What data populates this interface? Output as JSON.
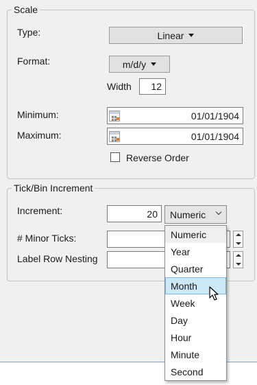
{
  "scale": {
    "title": "Scale",
    "type_label": "Type:",
    "type_value": "Linear",
    "format_label": "Format:",
    "format_value": "m/d/y",
    "width_label": "Width",
    "width_value": "12",
    "minimum_label": "Minimum:",
    "minimum_value": "01/01/1904",
    "maximum_label": "Maximum:",
    "maximum_value": "01/01/1904",
    "reverse_order_label": "Reverse Order",
    "reverse_order_checked": false
  },
  "tick": {
    "title": "Tick/Bin Increment",
    "increment_label": "Increment:",
    "increment_value": "20",
    "unit_value": "Numeric",
    "minor_ticks_label": "# Minor Ticks:",
    "minor_ticks_value": "",
    "label_row_nesting_label": "Label Row Nesting",
    "label_row_nesting_value": ""
  },
  "unit_dropdown": {
    "options": [
      "Numeric",
      "Year",
      "Quarter",
      "Month",
      "Week",
      "Day",
      "Hour",
      "Minute",
      "Second"
    ],
    "selected": "Numeric",
    "hovered": "Month"
  },
  "icons": {
    "calendar": "calendar-icon",
    "caret": "caret-down-icon",
    "chevron": "chevron-down-icon",
    "spinner": "spin-arrows-icon",
    "cursor": "mouse-pointer-icon"
  },
  "colors": {
    "hover_bg": "#cce8f4",
    "hover_border": "#7ab7e0",
    "panel_bg": "#f0f0f0"
  }
}
